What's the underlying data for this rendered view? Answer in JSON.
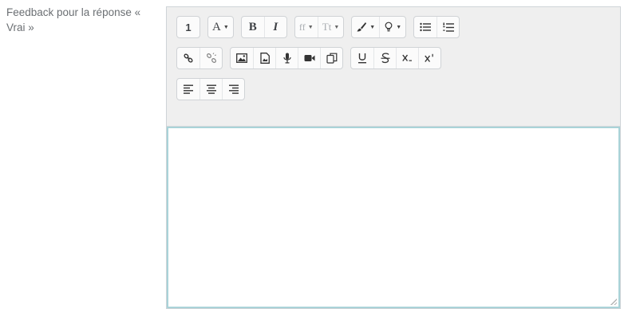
{
  "field": {
    "label": "Feedback pour la réponse « Vrai »"
  },
  "editor": {
    "content": "",
    "toolbar": {
      "row1": {
        "collapse": "1",
        "style_label": "A",
        "bold": "B",
        "italic": "I",
        "font_family": "ff",
        "font_size": "Tt"
      },
      "row3": {}
    }
  },
  "colors": {
    "toolbar_bg": "#efefef",
    "focus_border": "#a9d3d8",
    "label_text": "#6b6f73"
  }
}
